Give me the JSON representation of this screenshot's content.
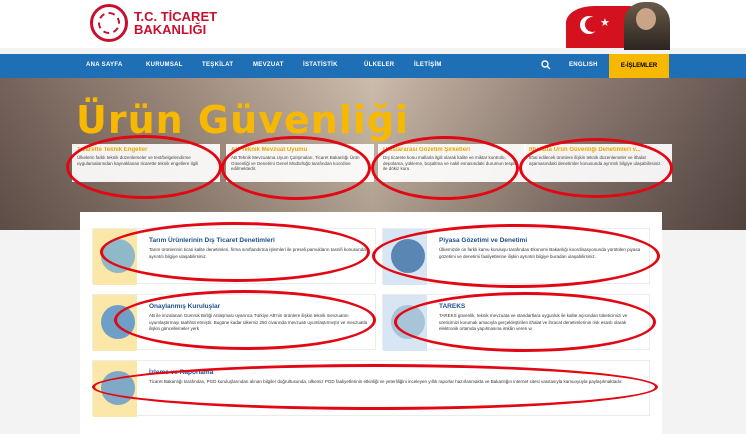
{
  "header": {
    "logo_line1": "T.C. TİCARET",
    "logo_line2": "BAKANLIĞI"
  },
  "nav": {
    "items": [
      "ANA SAYFA",
      "KURUMSAL",
      "TEŞKİLAT",
      "MEVZUAT",
      "İSTATİSTİK",
      "ÜLKELER",
      "İLETİŞİM"
    ],
    "english": "ENGLISH",
    "eislemler": "E-İŞLEMLER"
  },
  "hero": {
    "title": "Ürün Güvenliği",
    "cards": [
      {
        "title": "Ticarette Teknik Engeller",
        "body": "Ülkelerin farklı teknik düzenlemeler ve test/belgelendirme uygulamalarından kaynaklanan ticarette teknik engellere ilgili"
      },
      {
        "title": "AB Teknik Mevzuat Uyumu",
        "body": "AB Teknik Mevzuatına Uyum Çalışmaları, Ticaret Bakanlığı Ürün Güvenliği ve Denetimi Genel Müdürlüğü tarafından koordine edilmektedir."
      },
      {
        "title": "Uluslararası Gözetim Şirketleri",
        "body": "Dış ticarete konu mallarla ilgili olarak kalite ve miktar kontrolü, depolama, yükleme, boşaltma ve nakil esnasındaki durumun tespiti ile dökiz kuru"
      },
      {
        "title": "İthalatta Ürün Güvenliği Denetimleri v...",
        "body": "İthal edilecek ürünlere ilişkin teknik düzenlemeler ve ithalat aşamasındaki denetimler konusunda ayrıntılı bilgiye ulaşabilirsiniz."
      }
    ]
  },
  "services": [
    {
      "title": "Tarım Ürünlerinin Dış Ticaret Denetimleri",
      "body": "Tarım ürünlerinin ticari kalite denetimleri, firma sınıflandırma işlemleri ile preseli pamukların tasnifi konusunda ayrıntılı bilgiye ulaşabilirsiniz."
    },
    {
      "title": "Piyasa Gözetimi ve Denetimi",
      "body": "Ülkemizde on farklı kamu kuruluşu tarafından Ekonomi Bakanlığı koordinasyonunda yürütülen piyasa gözetimi ve denetimi faaliyetlerine ilişkin ayrıntılı bilgiye buradan ulaşabilirsiniz."
    },
    {
      "title": "Onaylanmış Kuruluşlar",
      "body": "AB ile imzalanan Gümrük Birliği Anlaşması uyarınca Türkiye AB'nin ürünlere ilişkin teknik mevzuatını uyumlaştırmayı taahhüt etmiştir. Bugüne kadar ülkemiz 250 civarında mevzuatı uyumlaştırmıştır ve mevzuatla ilişkin güncellemeler yerk"
    },
    {
      "title": "TAREKS",
      "body": "TAREKS güvenlik, teknik mevzuata ve standartlara uygunluk ile kalite açısından tüketicimizi ve üreticimizi korumak amacıyla gerçekleştirilen ithalat ve ihracat denetimlerinin risk esaslı olarak elektronik ortamda yapılmasına imkân veren w"
    },
    {
      "title": "İzleme ve Raporlama",
      "body": "Ticaret Bakanlığı tarafından, PGD kuruluşlarından alınan bilgiler doğrultusunda, ülkemiz PGD faaliyetlerinin etkinliği ve yeterliliğini inceleyen yıllık raporlar hazırlanmakta ve Bakanlığın internet sitesi vasıtasıyla kamuoyuyla paylaşılmaktadır."
    }
  ],
  "colors": {
    "nav_blue": "#1e6fb5",
    "accent_yellow": "#f6b800",
    "annotation_red": "#e30613",
    "brand_red": "#c8102e"
  },
  "icons": [
    "search-icon"
  ]
}
